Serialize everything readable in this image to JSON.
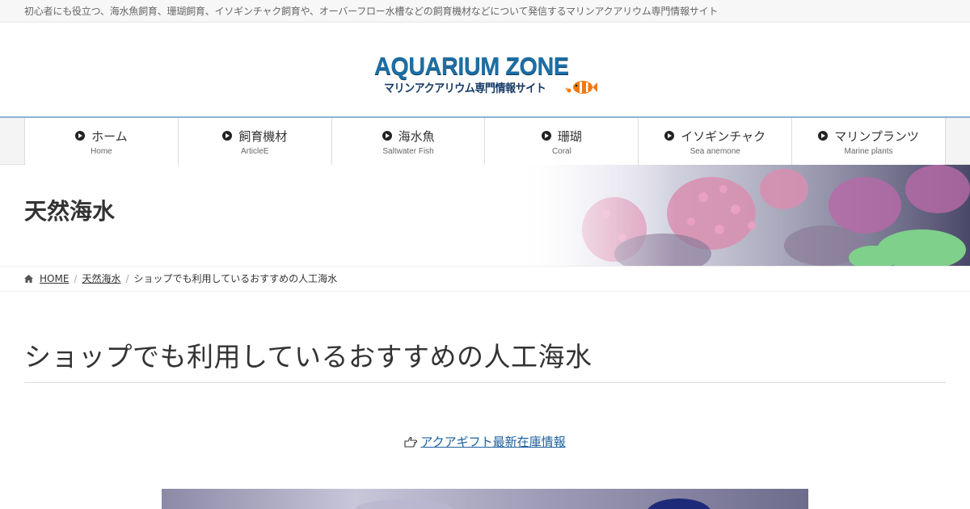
{
  "topbar": {
    "tagline": "初心者にも役立つ、海水魚飼育、珊瑚飼育、イソギンチャク飼育や、オーバーフロー水槽などの飼育機材などについて発信するマリンアクアリウム専門情報サイト"
  },
  "logo": {
    "main": "AQUARIUM ZONE",
    "sub": "マリンアクアリウム専門情報サイト"
  },
  "nav": {
    "items": [
      {
        "label": "ホーム",
        "sub": "Home"
      },
      {
        "label": "飼育機材",
        "sub": "ArticleE"
      },
      {
        "label": "海水魚",
        "sub": "Saltwater Fish"
      },
      {
        "label": "珊瑚",
        "sub": "Coral"
      },
      {
        "label": "イソギンチャク",
        "sub": "Sea anemone"
      },
      {
        "label": "マリンプランツ",
        "sub": "Marine plants"
      }
    ]
  },
  "hero": {
    "title": "天然海水"
  },
  "breadcrumb": {
    "home": "HOME",
    "category": "天然海水",
    "current": "ショップでも利用しているおすすめの人工海水"
  },
  "post": {
    "title": "ショップでも利用しているおすすめの人工海水",
    "link_text": "アクアギフト最新在庫情報"
  },
  "colors": {
    "nav_border": "#8fb2d1",
    "link": "#1a5f9e",
    "logo_blue": "#1d6fa5"
  },
  "icons": {
    "nav": "chevron-circle-right-icon",
    "breadcrumb_home": "home-icon",
    "link": "hand-pointing-right-icon"
  }
}
